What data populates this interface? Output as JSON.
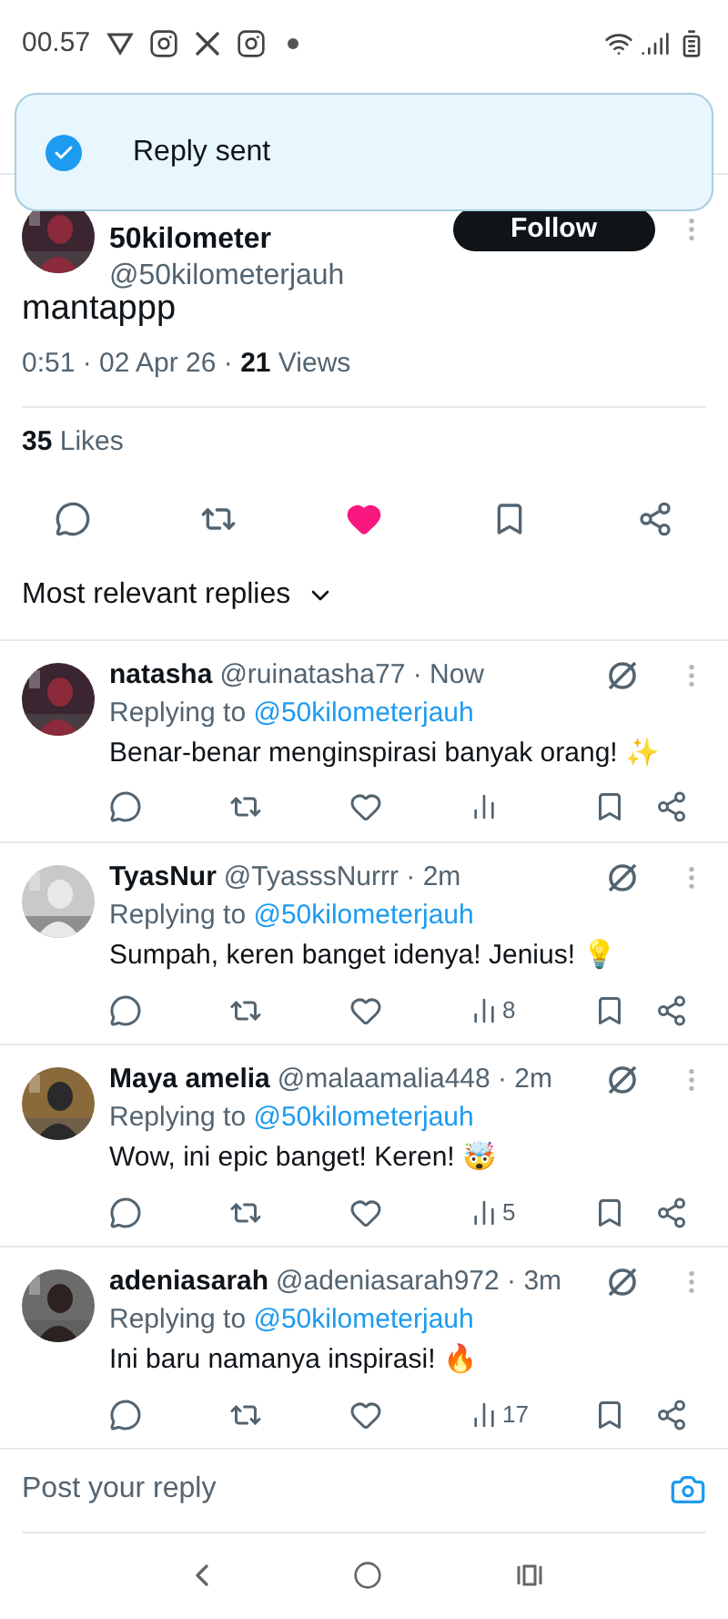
{
  "status_bar": {
    "time": "00.57"
  },
  "toast": {
    "message": "Reply sent"
  },
  "post": {
    "author_name": "50kilometer",
    "handle": "@50kilometerjauh",
    "follow_label": "Follow",
    "text": "mantappp",
    "time": "0:51 · 02 Apr 26 · ",
    "views_count": "21",
    "views_label": " Views",
    "likes_count": "35",
    "likes_label": " Likes",
    "liked": true,
    "bookmarked": false
  },
  "replies_sort": {
    "label": "Most relevant replies"
  },
  "replies": [
    {
      "name": "natasha",
      "handle": "@ruinatasha77 · Now",
      "replying_label": "Replying to ",
      "replying_handle": "@50kilometerjauh",
      "text": "Benar-benar menginspirasi banyak orang! ✨",
      "liked": false
    },
    {
      "name": "TyasNur",
      "handle": "@TyasssNurrr · 2m",
      "replying_label": "Replying to ",
      "replying_handle": "@50kilometerjauh",
      "text": "Sumpah, keren banget idenya! Jenius! 💡",
      "views": "8",
      "liked": false
    },
    {
      "name": "Maya amelia",
      "handle": "@malaamalia448 · 2m",
      "replying_label": "Replying to ",
      "replying_handle": "@50kilometerjauh",
      "text": "Wow, ini epic banget! Keren! 🤯",
      "views": "5",
      "liked": false
    },
    {
      "name": "adeniasarah",
      "handle": "@adeniasarah972 · 3m",
      "replying_label": "Replying to ",
      "replying_handle": "@50kilometerjauh",
      "text": "Ini baru namanya inspirasi! 🔥",
      "views": "17",
      "liked": false
    }
  ],
  "reply_box": {
    "placeholder": "Post your reply"
  }
}
